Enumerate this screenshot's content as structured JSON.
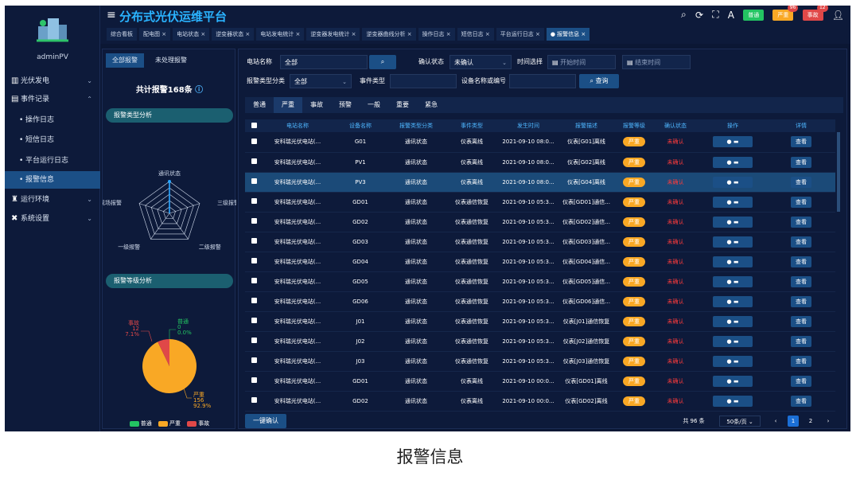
{
  "app": {
    "title": "分布式光伏运维平台"
  },
  "user": {
    "name": "adminPV"
  },
  "sidebar": {
    "items": [
      {
        "label": "光伏发电",
        "icon": "bar-chart-icon",
        "arrow": "⌄"
      },
      {
        "label": "事件记录",
        "icon": "record-icon",
        "arrow": "⌃"
      },
      {
        "label": "操作日志",
        "icon": "",
        "arrow": ""
      },
      {
        "label": "短信日志",
        "icon": "",
        "arrow": ""
      },
      {
        "label": "平台运行日志",
        "icon": "",
        "arrow": ""
      },
      {
        "label": "报警信息",
        "icon": "",
        "arrow": ""
      },
      {
        "label": "运行环境",
        "icon": "environment-icon",
        "arrow": "⌄"
      },
      {
        "label": "系统设置",
        "icon": "tools-icon",
        "arrow": "⌄"
      }
    ]
  },
  "tabs": [
    {
      "label": "综合看板"
    },
    {
      "label": "配电图 ×"
    },
    {
      "label": "电站状态 ×"
    },
    {
      "label": "逆变器状态 ×"
    },
    {
      "label": "电站发电统计 ×"
    },
    {
      "label": "逆变器发电统计 ×"
    },
    {
      "label": "逆变器曲线分析 ×"
    },
    {
      "label": "操作日志 ×"
    },
    {
      "label": "短信日志 ×"
    },
    {
      "label": "平台运行日志 ×"
    },
    {
      "label": "● 报警信息 ×"
    }
  ],
  "header": {
    "btn_normal": "普通",
    "btn_severe": "严重",
    "btn_severe_count": "96",
    "btn_accident": "事故",
    "btn_accident_count": "12",
    "colors": {
      "normal": "#23c462",
      "severe": "#f9a825",
      "accident": "#e04848"
    }
  },
  "left": {
    "tab_all": "全部报警",
    "tab_unhandled": "未处理报警",
    "total": "共计报警168条",
    "sec_type": "报警类型分析",
    "sec_level": "报警等级分析",
    "radar_labels": [
      "通讯状态",
      "三级报警",
      "二级报警",
      "一级报警",
      "现场报警"
    ],
    "pie": {
      "accident_label": "事故",
      "accident_value": "12",
      "accident_pct": "7.1%",
      "normal_label": "普通",
      "normal_value": "0",
      "normal_pct": "0.0%",
      "severe_label": "严重",
      "severe_value": "156",
      "severe_pct": "92.9%"
    },
    "legend": [
      "普通",
      "严重",
      "事故"
    ]
  },
  "filters": {
    "station_label": "电站名称",
    "station_value": "全部",
    "confirm_label": "确认状态",
    "confirm_value": "未确认",
    "time_label": "时间选择",
    "time_start": "开始时间",
    "time_end": "结束时间",
    "type_label": "报警类型分类",
    "type_value": "全部",
    "event_label": "事件类型",
    "event_value": "",
    "device_label": "设备名称或编号",
    "device_value": "",
    "query": "查询"
  },
  "levels": [
    "普通",
    "严重",
    "事故",
    "预警",
    "一般",
    "重要",
    "紧急"
  ],
  "table": {
    "headers": [
      "",
      "电站名称",
      "设备名称",
      "报警类型分类",
      "事件类型",
      "发生时间",
      "报警描述",
      "报警等级",
      "确认状态",
      "操作",
      "详情"
    ],
    "rows": [
      [
        "安科瑞光伏电站(...",
        "G01",
        "通讯状态",
        "仪表离线",
        "2021-09-10 08:0...",
        "仪表[G01]离线",
        "严重",
        "未确认",
        "●  ▬",
        "查看"
      ],
      [
        "安科瑞光伏电站(...",
        "PV1",
        "通讯状态",
        "仪表离线",
        "2021-09-10 08:0...",
        "仪表[G02]离线",
        "严重",
        "未确认",
        "●  ▬",
        "查看"
      ],
      [
        "安科瑞光伏电站(...",
        "PV3",
        "通讯状态",
        "仪表离线",
        "2021-09-10 08:0...",
        "仪表[G04]离线",
        "严重",
        "未确认",
        "●  ▬",
        "查看"
      ],
      [
        "安科瑞光伏电站(...",
        "GD01",
        "通讯状态",
        "仪表通信恢复",
        "2021-09-10 05:3...",
        "仪表[GD01]通信...",
        "严重",
        "未确认",
        "●  ▬",
        "查看"
      ],
      [
        "安科瑞光伏电站(...",
        "GD02",
        "通讯状态",
        "仪表通信恢复",
        "2021-09-10 05:3...",
        "仪表[GD02]通信...",
        "严重",
        "未确认",
        "●  ▬",
        "查看"
      ],
      [
        "安科瑞光伏电站(...",
        "GD03",
        "通讯状态",
        "仪表通信恢复",
        "2021-09-10 05:3...",
        "仪表[GD03]通信...",
        "严重",
        "未确认",
        "●  ▬",
        "查看"
      ],
      [
        "安科瑞光伏电站(...",
        "GD04",
        "通讯状态",
        "仪表通信恢复",
        "2021-09-10 05:3...",
        "仪表[GD04]通信...",
        "严重",
        "未确认",
        "●  ▬",
        "查看"
      ],
      [
        "安科瑞光伏电站(...",
        "GD05",
        "通讯状态",
        "仪表通信恢复",
        "2021-09-10 05:3...",
        "仪表[GD05]通信...",
        "严重",
        "未确认",
        "●  ▬",
        "查看"
      ],
      [
        "安科瑞光伏电站(...",
        "GD06",
        "通讯状态",
        "仪表通信恢复",
        "2021-09-10 05:3...",
        "仪表[GD06]通信...",
        "严重",
        "未确认",
        "●  ▬",
        "查看"
      ],
      [
        "安科瑞光伏电站(...",
        "J01",
        "通讯状态",
        "仪表通信恢复",
        "2021-09-10 05:3...",
        "仪表[J01]通信恢复",
        "严重",
        "未确认",
        "●  ▬",
        "查看"
      ],
      [
        "安科瑞光伏电站(...",
        "J02",
        "通讯状态",
        "仪表通信恢复",
        "2021-09-10 05:3...",
        "仪表[J02]通信恢复",
        "严重",
        "未确认",
        "●  ▬",
        "查看"
      ],
      [
        "安科瑞光伏电站(...",
        "J03",
        "通讯状态",
        "仪表通信恢复",
        "2021-09-10 05:3...",
        "仪表[J03]通信恢复",
        "严重",
        "未确认",
        "●  ▬",
        "查看"
      ],
      [
        "安科瑞光伏电站(...",
        "GD01",
        "通讯状态",
        "仪表离线",
        "2021-09-10 00:0...",
        "仪表[GD01]离线",
        "严重",
        "未确认",
        "●  ▬",
        "查看"
      ],
      [
        "安科瑞光伏电站(...",
        "GD02",
        "通讯状态",
        "仪表离线",
        "2021-09-10 00:0...",
        "仪表[GD02]离线",
        "严重",
        "未确认",
        "●  ▬",
        "查看"
      ]
    ]
  },
  "footer": {
    "confirm_all": "一键确认",
    "total": "共 96 条",
    "page_size": "50条/页",
    "prev": "‹",
    "page1": "1",
    "page2": "2",
    "next": "›"
  },
  "caption": "报警信息"
}
